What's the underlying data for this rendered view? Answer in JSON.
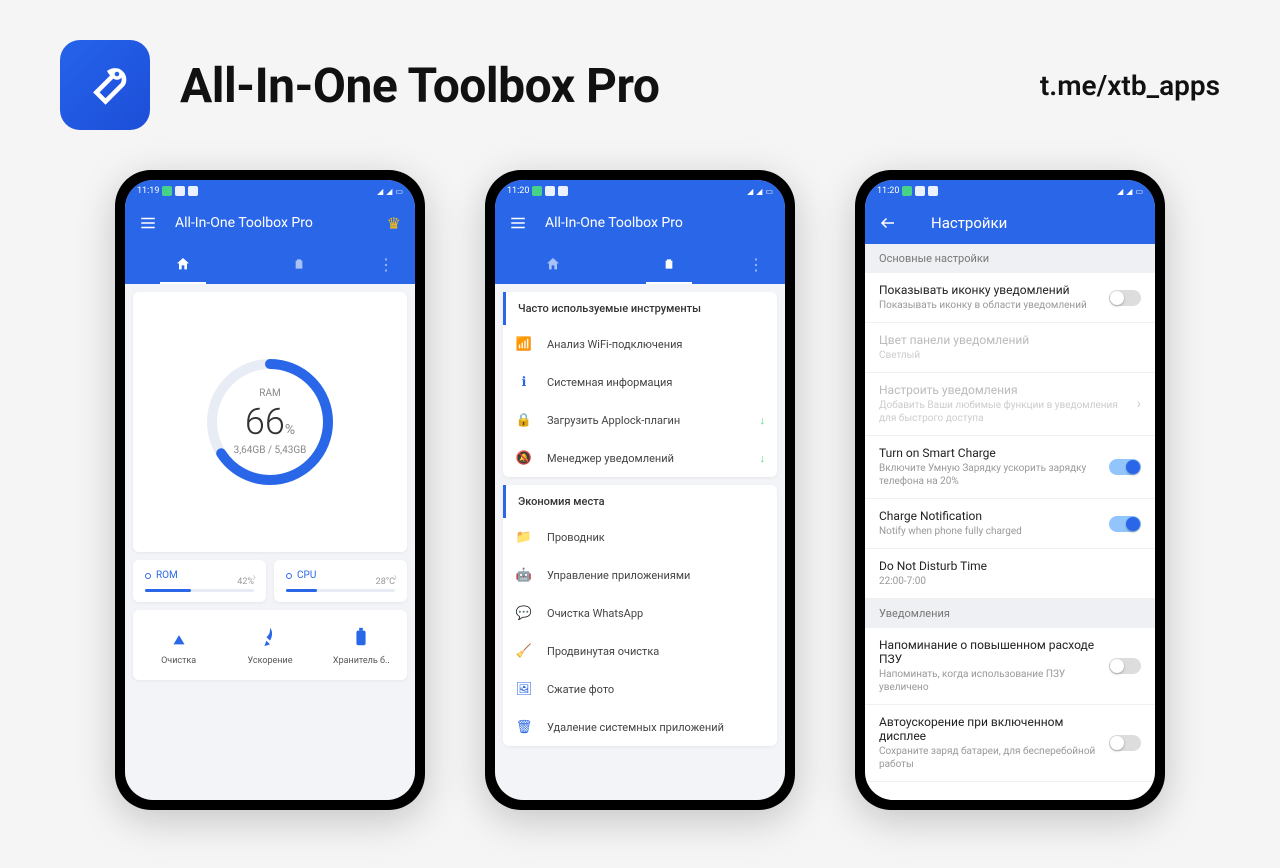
{
  "header": {
    "title": "All-In-One Toolbox Pro",
    "link": "t.me/xtb_apps"
  },
  "phone1": {
    "time": "11:19",
    "appbar_title": "All-In-One Toolbox Pro",
    "ram": {
      "label": "RAM",
      "value": "66",
      "pct": "%",
      "sub": "3,64GB / 5,43GB",
      "percent": 66
    },
    "stats": {
      "rom": {
        "label": "ROM",
        "value": "42%",
        "fill": 42
      },
      "cpu": {
        "label": "CPU",
        "value": "28°C",
        "fill": 28
      }
    },
    "actions": {
      "clean": "Очистка",
      "boost": "Ускорение",
      "storage": "Хранитель б.."
    }
  },
  "phone2": {
    "time": "11:20",
    "appbar_title": "All-In-One Toolbox Pro",
    "section1": "Часто используемые инструменты",
    "tools1": {
      "wifi": "Анализ WiFi-подключения",
      "sysinfo": "Системная информация",
      "applock": "Загрузить Applock-плагин",
      "notif": "Менеджер уведомлений"
    },
    "section2": "Экономия места",
    "tools2": {
      "explorer": "Проводник",
      "apps": "Управление приложениями",
      "whatsapp": "Очистка WhatsApp",
      "advclean": "Продвинутая очистка",
      "photo": "Сжатие фото",
      "sysapp": "Удаление системных приложений"
    }
  },
  "phone3": {
    "time": "11:20",
    "title": "Настройки",
    "section1": "Основные настройки",
    "rows": {
      "notif_icon": {
        "label": "Показывать иконку уведомлений",
        "sub": "Показывать иконку в области уведомлений"
      },
      "panel_color": {
        "label": "Цвет панели уведомлений",
        "sub": "Светлый"
      },
      "customize": {
        "label": "Настроить уведомления",
        "sub": "Добавить Ваши любимые функции в уведомления для быстрого доступа"
      },
      "smart_charge": {
        "label": "Turn on Smart Charge",
        "sub": "Включите Умную Зарядку ускорить зарядку телефона на 20%"
      },
      "charge_notif": {
        "label": "Charge Notification",
        "sub": "Notify when phone fully charged"
      },
      "dnd": {
        "label": "Do Not Disturb Time",
        "sub": "22:00-7:00"
      }
    },
    "section2": "Уведомления",
    "rows2": {
      "pzu": {
        "label": "Напоминание о повышенном расходе ПЗУ",
        "sub": "Напоминать, когда использование ПЗУ увеличено"
      },
      "autoboost": {
        "label": "Автоускорение при включенном дисплее",
        "sub": "Сохраните заряд батареи, для бесперебойной работы"
      }
    }
  }
}
